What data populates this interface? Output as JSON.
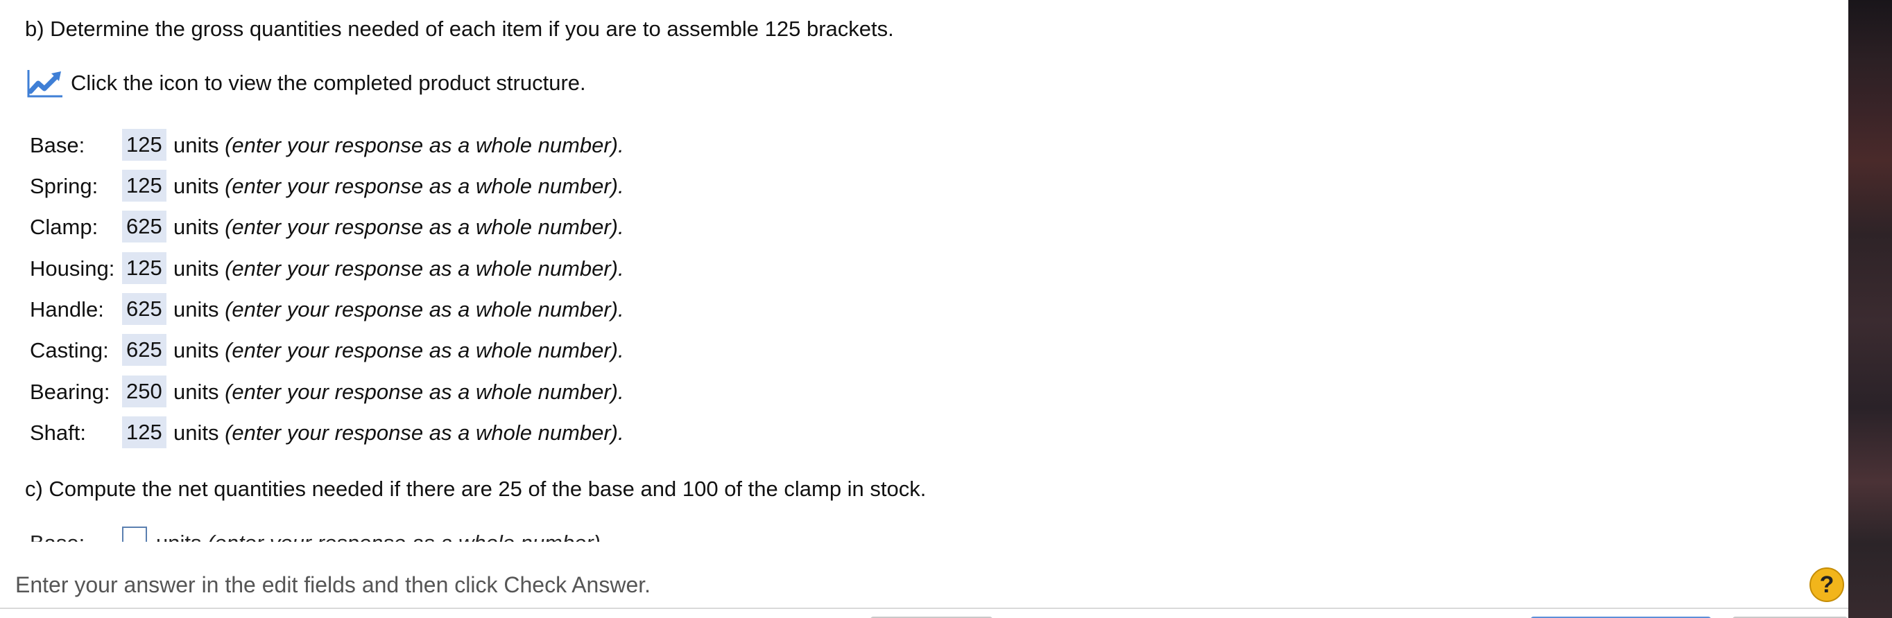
{
  "part_b": {
    "text": "b) Determine the gross quantities needed of each item if you are to assemble 125 brackets."
  },
  "chart_link": {
    "icon": "line-chart-icon",
    "text": "Click the icon to view the completed product structure."
  },
  "rows": [
    {
      "label": "Base:",
      "value": "125",
      "units": "units",
      "hint": "(enter your response as a whole number)."
    },
    {
      "label": "Spring:",
      "value": "125",
      "units": "units",
      "hint": "(enter your response as a whole number)."
    },
    {
      "label": "Clamp:",
      "value": "625",
      "units": "units",
      "hint": "(enter your response as a whole number)."
    },
    {
      "label": "Housing:",
      "value": "125",
      "units": "units",
      "hint": "(enter your response as a whole number)."
    },
    {
      "label": "Handle:",
      "value": "625",
      "units": "units",
      "hint": "(enter your response as a whole number)."
    },
    {
      "label": "Casting:",
      "value": "625",
      "units": "units",
      "hint": "(enter your response as a whole number)."
    },
    {
      "label": "Bearing:",
      "value": "250",
      "units": "units",
      "hint": "(enter your response as a whole number)."
    },
    {
      "label": "Shaft:",
      "value": "125",
      "units": "units",
      "hint": "(enter your response as a whole number)."
    }
  ],
  "part_c": {
    "text": "c) Compute the net quantities needed if there are 25 of the base and 100 of the clamp in stock.",
    "first_row": {
      "label": "Base:",
      "value": "",
      "units": "units",
      "hint": "(enter your response as a whole number)."
    }
  },
  "footer": {
    "instruction": "Enter your answer in the edit fields and then click Check Answer.",
    "help_label": "?"
  },
  "colors": {
    "answer_fill": "#dfe6f3",
    "icon_blue": "#3f7fd6",
    "help_yellow": "#f2b51b"
  }
}
